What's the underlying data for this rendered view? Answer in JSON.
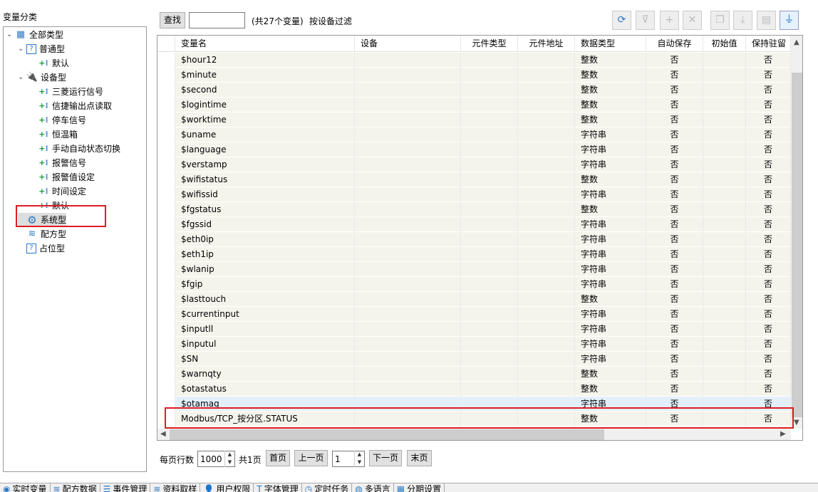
{
  "tree": {
    "title": "变量分类",
    "nodes": [
      {
        "label": "全部类型",
        "icon": "all-types-icon"
      },
      {
        "label": "普通型",
        "icon": "question-icon"
      },
      {
        "label": "默认",
        "icon": "variable-group-icon"
      },
      {
        "label": "设备型",
        "icon": "plug-icon"
      },
      {
        "label": "三菱运行信号",
        "icon": "variable-group-icon"
      },
      {
        "label": "信捷输出点读取",
        "icon": "variable-group-icon"
      },
      {
        "label": "停车信号",
        "icon": "variable-group-icon"
      },
      {
        "label": "恒温箱",
        "icon": "variable-group-icon"
      },
      {
        "label": "手动自动状态切换",
        "icon": "variable-group-icon"
      },
      {
        "label": "报警信号",
        "icon": "variable-group-icon"
      },
      {
        "label": "报警值设定",
        "icon": "variable-group-icon"
      },
      {
        "label": "时间设定",
        "icon": "variable-group-icon"
      },
      {
        "label": "默认",
        "icon": "variable-group-icon"
      },
      {
        "label": "系统型",
        "icon": "gear-icon"
      },
      {
        "label": "配方型",
        "icon": "database-icon"
      },
      {
        "label": "占位型",
        "icon": "question-icon"
      }
    ]
  },
  "toolbar": {
    "search_label": "查找",
    "search_value": "",
    "count_text": "(共27个变量)",
    "filter_label": "按设备过滤"
  },
  "table": {
    "columns": [
      "变量名",
      "设备",
      "元件类型",
      "元件地址",
      "数据类型",
      "自动保存",
      "初始值",
      "保持驻留"
    ],
    "rows": [
      [
        "$hour12",
        "",
        "",
        "",
        "整数",
        "否",
        "",
        "否"
      ],
      [
        "$minute",
        "",
        "",
        "",
        "整数",
        "否",
        "",
        "否"
      ],
      [
        "$second",
        "",
        "",
        "",
        "整数",
        "否",
        "",
        "否"
      ],
      [
        "$logintime",
        "",
        "",
        "",
        "整数",
        "否",
        "",
        "否"
      ],
      [
        "$worktime",
        "",
        "",
        "",
        "整数",
        "否",
        "",
        "否"
      ],
      [
        "$uname",
        "",
        "",
        "",
        "字符串",
        "否",
        "",
        "否"
      ],
      [
        "$language",
        "",
        "",
        "",
        "字符串",
        "否",
        "",
        "否"
      ],
      [
        "$verstamp",
        "",
        "",
        "",
        "字符串",
        "否",
        "",
        "否"
      ],
      [
        "$wifistatus",
        "",
        "",
        "",
        "整数",
        "否",
        "",
        "否"
      ],
      [
        "$wifissid",
        "",
        "",
        "",
        "字符串",
        "否",
        "",
        "否"
      ],
      [
        "$fgstatus",
        "",
        "",
        "",
        "整数",
        "否",
        "",
        "否"
      ],
      [
        "$fgssid",
        "",
        "",
        "",
        "字符串",
        "否",
        "",
        "否"
      ],
      [
        "$eth0ip",
        "",
        "",
        "",
        "字符串",
        "否",
        "",
        "否"
      ],
      [
        "$eth1ip",
        "",
        "",
        "",
        "字符串",
        "否",
        "",
        "否"
      ],
      [
        "$wlanip",
        "",
        "",
        "",
        "字符串",
        "否",
        "",
        "否"
      ],
      [
        "$fgip",
        "",
        "",
        "",
        "字符串",
        "否",
        "",
        "否"
      ],
      [
        "$lasttouch",
        "",
        "",
        "",
        "整数",
        "否",
        "",
        "否"
      ],
      [
        "$currentinput",
        "",
        "",
        "",
        "字符串",
        "否",
        "",
        "否"
      ],
      [
        "$inputll",
        "",
        "",
        "",
        "字符串",
        "否",
        "",
        "否"
      ],
      [
        "$inputul",
        "",
        "",
        "",
        "字符串",
        "否",
        "",
        "否"
      ],
      [
        "$SN",
        "",
        "",
        "",
        "字符串",
        "否",
        "",
        "否"
      ],
      [
        "$warnqty",
        "",
        "",
        "",
        "整数",
        "否",
        "",
        "否"
      ],
      [
        "$otastatus",
        "",
        "",
        "",
        "整数",
        "否",
        "",
        "否"
      ],
      [
        "$otamag",
        "",
        "",
        "",
        "字符串",
        "否",
        "",
        "否"
      ],
      [
        "Modbus/TCP_按分区.STATUS",
        "",
        "",
        "",
        "整数",
        "否",
        "",
        "否"
      ]
    ]
  },
  "pager": {
    "rows_label": "每页行数",
    "rows_value": "1000",
    "total_label": "共1页",
    "first": "首页",
    "prev": "上一页",
    "page_value": "1",
    "next": "下一页",
    "last": "末页"
  },
  "bottom_tabs": [
    "实时变量",
    "配方数据",
    "事件管理",
    "资料取样",
    "用户权限",
    "字体管理",
    "定时任务",
    "多语言",
    "分期设置"
  ],
  "colors": {
    "highlight": "#e01b24",
    "row": "#f5f4ec",
    "hover": "#e3f0fb",
    "accent": "#2b78c5"
  }
}
